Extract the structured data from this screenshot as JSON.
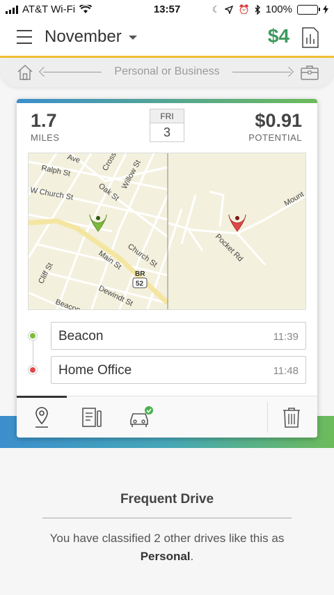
{
  "status_bar": {
    "carrier": "AT&T Wi-Fi",
    "time": "13:57",
    "battery": "100%"
  },
  "header": {
    "month": "November",
    "earnings": "$4"
  },
  "classify": {
    "label": "Personal or Business"
  },
  "drive": {
    "miles": "1.7",
    "miles_label": "MILES",
    "day_of_week": "FRI",
    "day": "3",
    "potential": "$0.91",
    "potential_label": "POTENTIAL"
  },
  "map": {
    "streets": [
      "Ave",
      "Ralph St",
      "Cross",
      "Willow St",
      "W Church St",
      "Oak St",
      "Church St",
      "Main St",
      "Cliff St",
      "Dewindt St",
      "Beacon",
      "Pocket Rd",
      "Mount"
    ],
    "route_badge_top": "BR",
    "route_badge_num": "52",
    "start_color": "#7cbc3a",
    "end_color": "#e04848"
  },
  "stops": [
    {
      "name": "Beacon",
      "time": "11:39"
    },
    {
      "name": "Home Office",
      "time": "11:48"
    }
  ],
  "frequent": {
    "title": "Frequent Drive",
    "text_before": "You have classified 2 other drives like this as ",
    "classification": "Personal",
    "text_after": "."
  },
  "colors": {
    "accent_green": "#3d9a5e",
    "gold": "#f0c231",
    "gradient_start": "#3b8fcc",
    "gradient_end": "#6cbb5a"
  }
}
